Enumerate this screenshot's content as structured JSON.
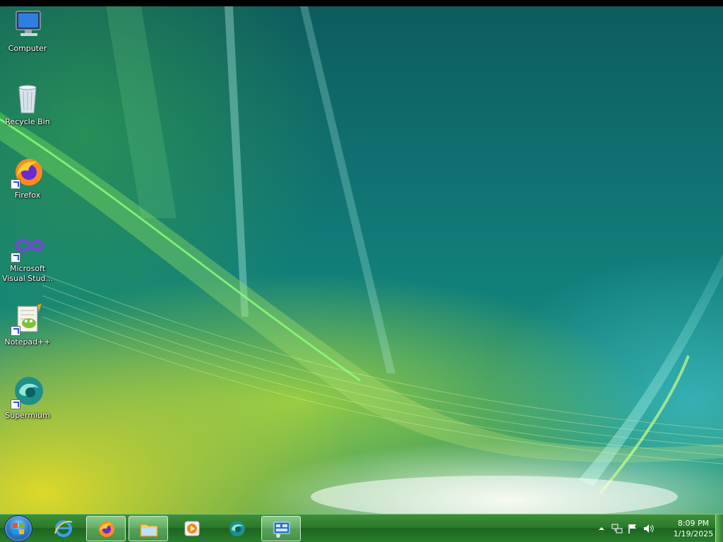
{
  "desktop": {
    "icons": [
      {
        "label": "Computer",
        "icon": "computer-icon",
        "shortcut": false
      },
      {
        "label": "Recycle Bin",
        "icon": "recycle-bin-icon",
        "shortcut": false
      },
      {
        "label": "Firefox",
        "icon": "firefox-icon",
        "shortcut": true
      },
      {
        "label": "Microsoft Visual Stud...",
        "icon": "visual-studio-icon",
        "shortcut": true
      },
      {
        "label": "Notepad++",
        "icon": "notepad-plus-plus-icon",
        "shortcut": true
      },
      {
        "label": "Supermium",
        "icon": "supermium-icon",
        "shortcut": true
      }
    ]
  },
  "taskbar": {
    "start": {
      "icon": "start-orb-icon"
    },
    "pinned": [
      {
        "icon": "internet-explorer-icon",
        "active": false
      },
      {
        "icon": "firefox-icon",
        "active": true
      },
      {
        "icon": "file-explorer-icon",
        "active": true
      },
      {
        "icon": "media-player-icon",
        "active": false
      },
      {
        "icon": "supermium-icon",
        "active": false
      },
      {
        "icon": "control-panel-icon",
        "active": true
      }
    ],
    "tray": {
      "icons": [
        "show-hidden-icons-arrow",
        "network-icon",
        "action-center-flag-icon",
        "volume-icon"
      ],
      "time": "8:09 PM",
      "date": "1/19/2025"
    }
  },
  "colors": {
    "taskbar": "#2a7a2a",
    "wallpaper_teal": "#12807a",
    "wallpaper_yellow": "#e6dc28"
  }
}
